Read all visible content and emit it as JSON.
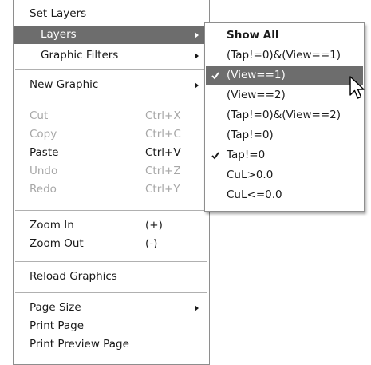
{
  "main_menu": {
    "set_layers": "Set Layers",
    "layers": "Layers",
    "graphic_filters": "Graphic Filters",
    "new_graphic": "New Graphic",
    "cut": {
      "label": "Cut",
      "shortcut": "Ctrl+X"
    },
    "copy": {
      "label": "Copy",
      "shortcut": "Ctrl+C"
    },
    "paste": {
      "label": "Paste",
      "shortcut": "Ctrl+V"
    },
    "undo": {
      "label": "Undo",
      "shortcut": "Ctrl+Z"
    },
    "redo": {
      "label": "Redo",
      "shortcut": "Ctrl+Y"
    },
    "zoom_in": {
      "label": "Zoom In",
      "shortcut": "(+)"
    },
    "zoom_out": {
      "label": "Zoom Out",
      "shortcut": "(-)"
    },
    "reload_graphics": "Reload Graphics",
    "page_size": "Page Size",
    "print_page": "Print Page",
    "print_preview_page": "Print Preview Page"
  },
  "layers_submenu": {
    "items": [
      {
        "label": "Show All",
        "checked": false,
        "bold": true
      },
      {
        "label": "(Tap!=0)&(View==1)",
        "checked": false
      },
      {
        "label": "(View==1)",
        "checked": true,
        "highlighted": true
      },
      {
        "label": "(View==2)",
        "checked": false
      },
      {
        "label": "(Tap!=0)&(View==2)",
        "checked": false
      },
      {
        "label": "(Tap!=0)",
        "checked": false
      },
      {
        "label": "Tap!=0",
        "checked": true
      },
      {
        "label": "CuL>0.0",
        "checked": false
      },
      {
        "label": "CuL<=0.0",
        "checked": false
      }
    ]
  },
  "colors": {
    "highlight": "#6d6d6d",
    "disabled_text": "#a7a7a7",
    "border": "#8e8e8e"
  },
  "icons": {
    "submenu_arrow": "chevron-right-icon",
    "check": "checkmark-icon",
    "cursor": "mouse-pointer-icon"
  }
}
